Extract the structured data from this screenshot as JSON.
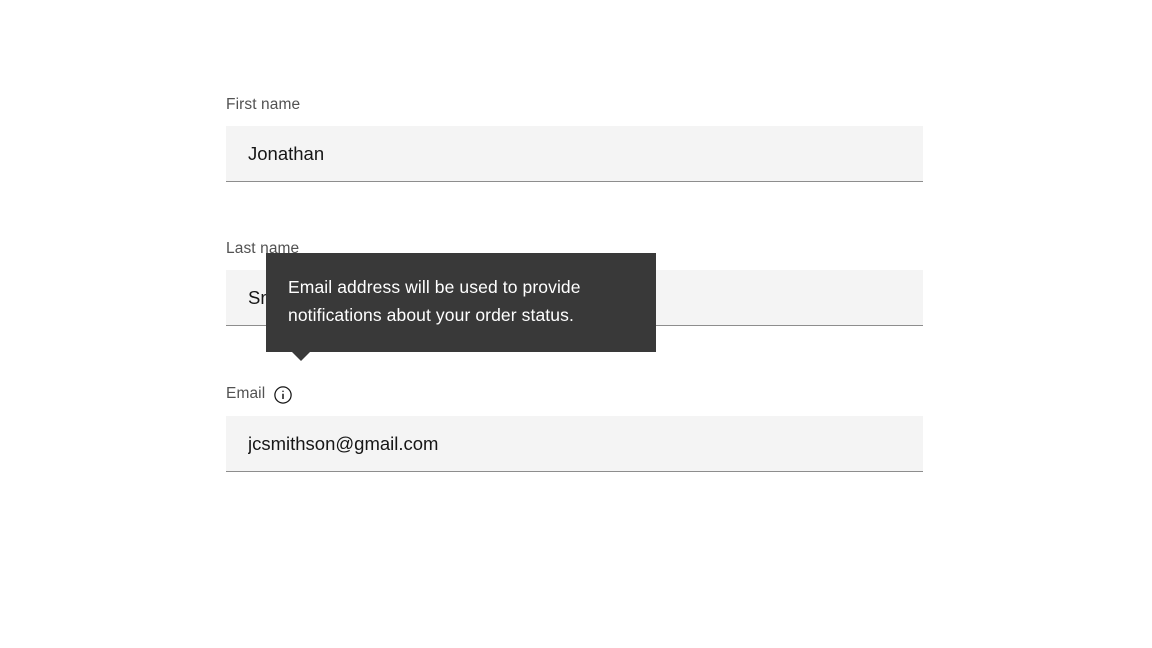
{
  "form": {
    "first_name": {
      "label": "First name",
      "value": "Jonathan"
    },
    "last_name": {
      "label": "Last name",
      "value": "Smithson",
      "value_cropped_prefix": "S"
    },
    "email": {
      "label": "Email",
      "value": "jcsmithson@gmail.com",
      "tooltip": "Email address will be used to provide notifications about your order status."
    }
  }
}
